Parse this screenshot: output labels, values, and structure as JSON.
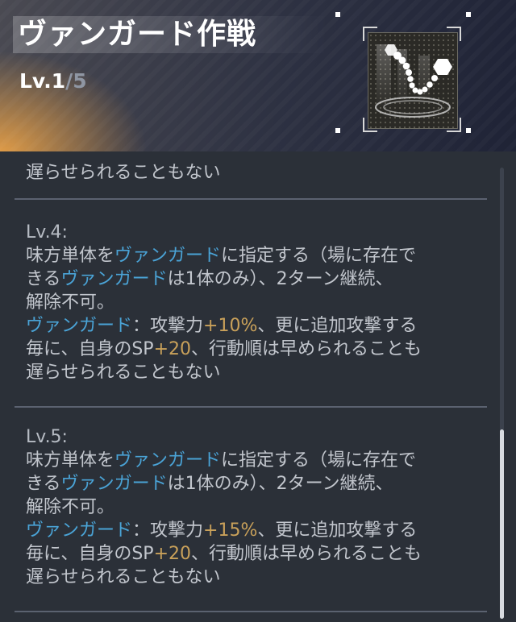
{
  "header": {
    "title": "ヴァンガード作戦",
    "level_prefix": "Lv.",
    "level_current": "1",
    "level_sep": "/",
    "level_max": "5",
    "icon": "chain-hexagon-skill-icon"
  },
  "entries": [
    {
      "partial_last_line": "遅らせられることもない"
    },
    {
      "label": "Lv.4:",
      "l1a": "味方単体を",
      "l1b": "ヴァンガード",
      "l1c": "に指定する（場に存在で",
      "l2a": "きる",
      "l2b": "ヴァンガード",
      "l2c": "は1体のみ）、2ターン継続、",
      "l3": "解除不可。",
      "l4a": "ヴァンガード",
      "l4b": "：攻撃力",
      "l4c": "+10%",
      "l4d": "、更に追加攻撃する",
      "l5a": "毎に、自身のSP",
      "l5b": "+20",
      "l5c": "、行動順は早められることも",
      "l6": "遅らせられることもない"
    },
    {
      "label": "Lv.5:",
      "l1a": "味方単体を",
      "l1b": "ヴァンガード",
      "l1c": "に指定する（場に存在で",
      "l2a": "きる",
      "l2b": "ヴァンガード",
      "l2c": "は1体のみ）、2ターン継続、",
      "l3": "解除不可。",
      "l4a": "ヴァンガード",
      "l4b": "：攻撃力",
      "l4c": "+15%",
      "l4d": "、更に追加攻撃する",
      "l5a": "毎に、自身のSP",
      "l5b": "+20",
      "l5c": "、行動順は早められることも",
      "l6": "遅らせられることもない"
    }
  ],
  "colors": {
    "keyword": "#4aa3d6",
    "number": "#c9a15a",
    "text": "#c2c6cd",
    "background": "#2b3038"
  },
  "scroll": {
    "position_fraction": 0.58
  }
}
